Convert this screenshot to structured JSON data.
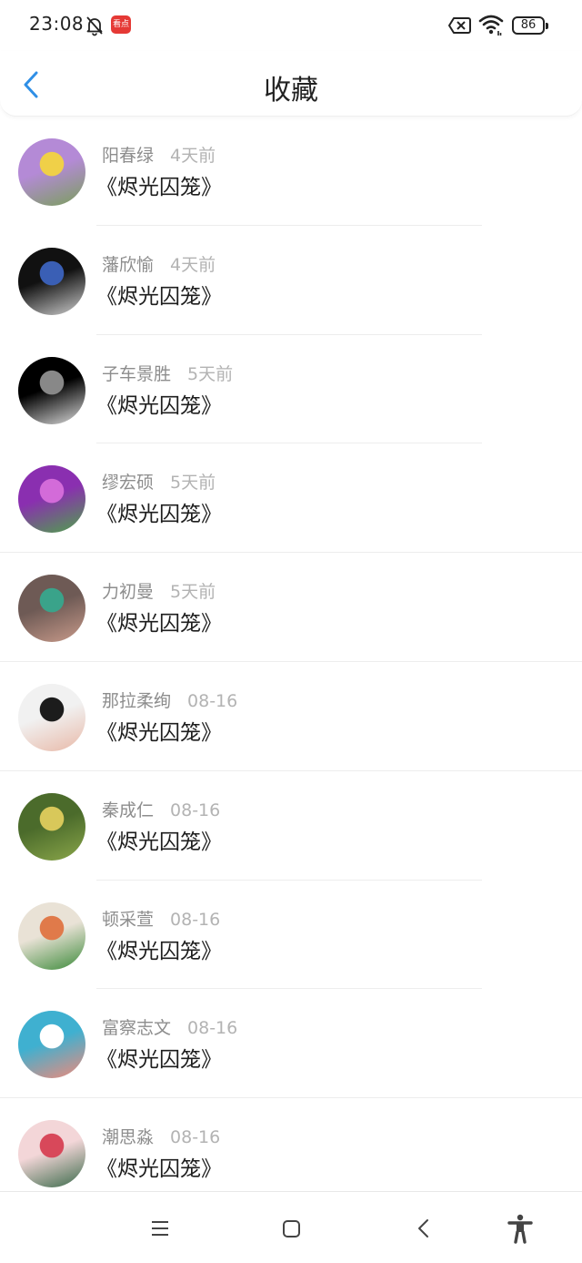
{
  "status_bar": {
    "time": "23:08",
    "news_badge": "看点",
    "battery": "86"
  },
  "header": {
    "title": "收藏"
  },
  "items": [
    {
      "name": "阳春绿",
      "time": "4天前",
      "title": "《烬光囚笼》",
      "avatar_colors": [
        "#b48ad6",
        "#f0d048",
        "#7a9f5c"
      ]
    },
    {
      "name": "藩欣愉",
      "time": "4天前",
      "title": "《烬光囚笼》",
      "avatar_colors": [
        "#111111",
        "#3a5fb5",
        "#cfcfcf"
      ]
    },
    {
      "name": "子车景胜",
      "time": "5天前",
      "title": "《烬光囚笼》",
      "avatar_colors": [
        "#000000",
        "#888888",
        "#dddddd"
      ]
    },
    {
      "name": "缪宏硕",
      "time": "5天前",
      "title": "《烬光囚笼》",
      "avatar_colors": [
        "#8a2fb0",
        "#d36bd9",
        "#4ea24a"
      ]
    },
    {
      "name": "力初曼",
      "time": "5天前",
      "title": "《烬光囚笼》",
      "avatar_colors": [
        "#6e5a55",
        "#3aa38a",
        "#c89a8a"
      ]
    },
    {
      "name": "那拉柔绚",
      "time": "08-16",
      "title": "《烬光囚笼》",
      "avatar_colors": [
        "#f1f1f1",
        "#1c1c1c",
        "#e8b9a8"
      ]
    },
    {
      "name": "秦成仁",
      "time": "08-16",
      "title": "《烬光囚笼》",
      "avatar_colors": [
        "#4b6b2b",
        "#d8c85a",
        "#8aa64a"
      ]
    },
    {
      "name": "顿采萱",
      "time": "08-16",
      "title": "《烬光囚笼》",
      "avatar_colors": [
        "#e9e2d6",
        "#e07a4a",
        "#3c8a3a"
      ]
    },
    {
      "name": "富察志文",
      "time": "08-16",
      "title": "《烬光囚笼》",
      "avatar_colors": [
        "#3fb0d0",
        "#ffffff",
        "#f08a7a"
      ]
    },
    {
      "name": "潮思淼",
      "time": "08-16",
      "title": "《烬光囚笼》",
      "avatar_colors": [
        "#f3d6d8",
        "#d8485a",
        "#3a6a4a"
      ]
    }
  ],
  "colors": {
    "accent": "#2f8fe6",
    "name_text": "#8d8d8d",
    "time_text": "#b3b3b3"
  },
  "icons": {
    "back": "chevron-left-icon",
    "bell": "bell-off-icon",
    "sim": "sim-x-icon",
    "wifi": "wifi-icon",
    "nav_menu": "menu-icon",
    "nav_home": "square-icon",
    "nav_back": "chevron-left-icon",
    "nav_access": "accessibility-icon"
  }
}
